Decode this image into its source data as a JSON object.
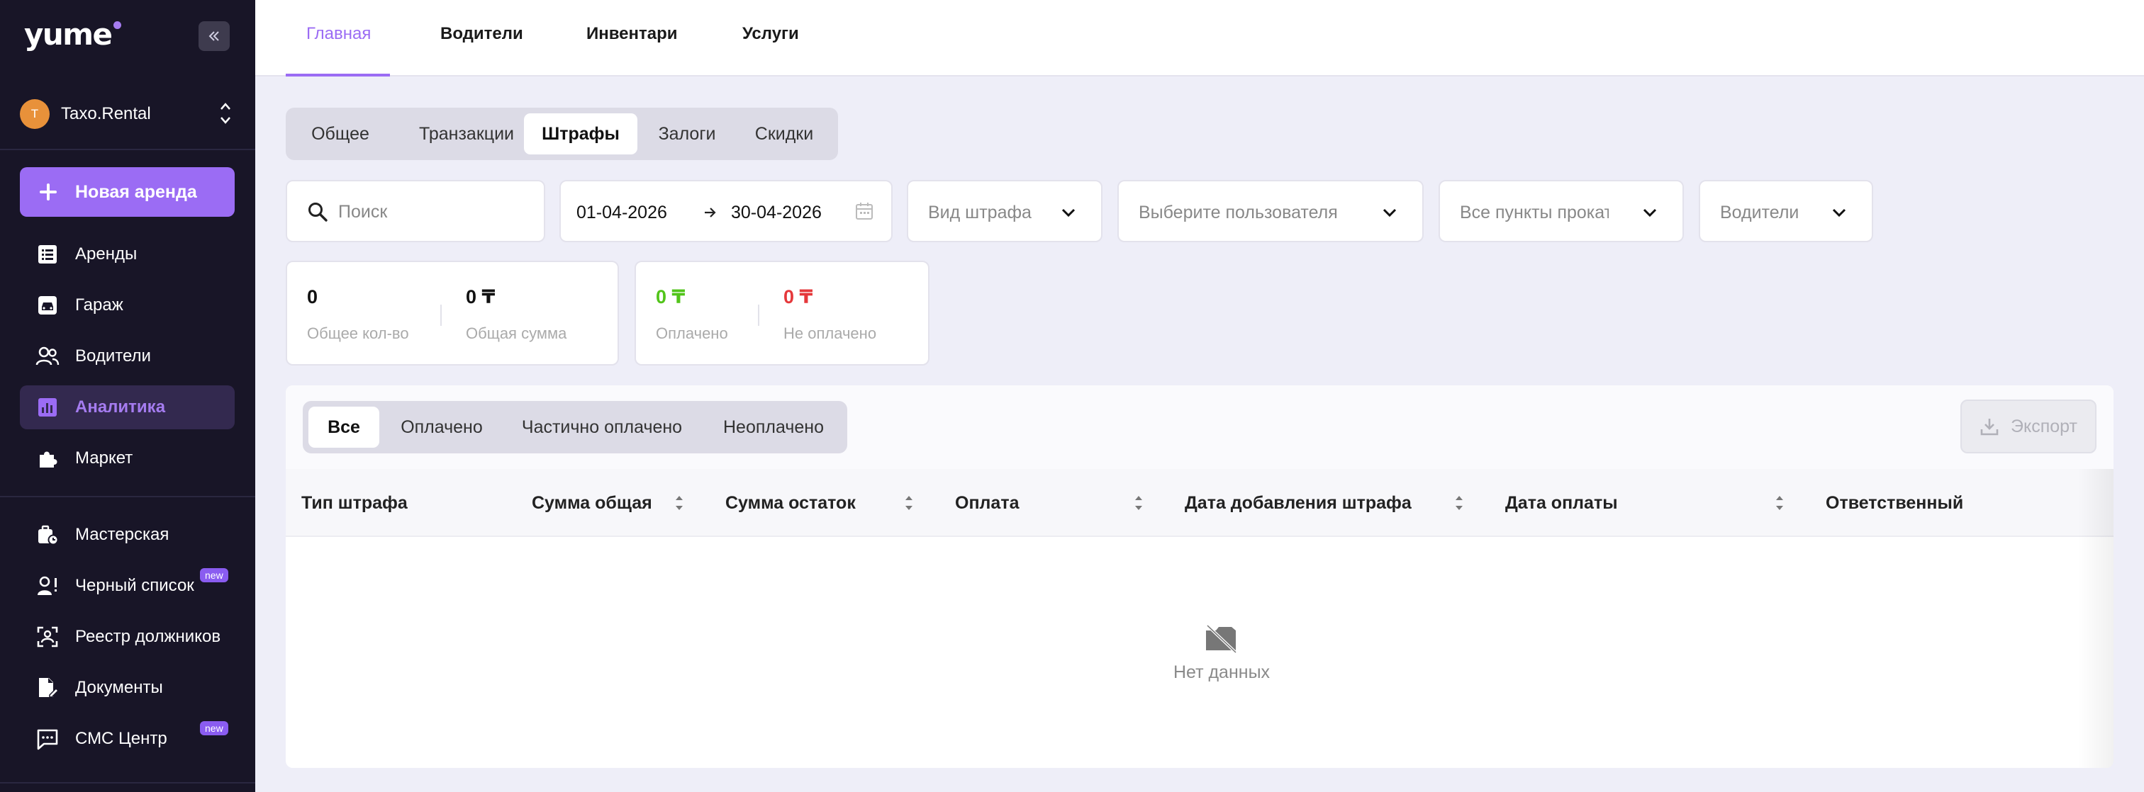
{
  "app": {
    "logo": "yume"
  },
  "org": {
    "initial": "T",
    "name": "Taxo.Rental"
  },
  "sidebar": {
    "new_rent_label": "Новая аренда",
    "items": [
      {
        "label": "Аренды",
        "icon": "list-icon"
      },
      {
        "label": "Гараж",
        "icon": "car-icon"
      },
      {
        "label": "Водители",
        "icon": "users-icon"
      },
      {
        "label": "Аналитика",
        "icon": "chart-icon",
        "active": true
      },
      {
        "label": "Маркет",
        "icon": "puzzle-icon"
      },
      {
        "label": "Мастерская",
        "icon": "toolbox-icon"
      },
      {
        "label": "Черный список",
        "icon": "user-alert-icon",
        "badge": "new"
      },
      {
        "label": "Реестр должников",
        "icon": "user-scan-icon"
      },
      {
        "label": "Документы",
        "icon": "document-edit-icon"
      },
      {
        "label": "СМС Центр",
        "icon": "message-icon",
        "badge": "new"
      }
    ]
  },
  "top_tabs": [
    {
      "label": "Главная",
      "active": true
    },
    {
      "label": "Водители"
    },
    {
      "label": "Инвентари"
    },
    {
      "label": "Услуги"
    }
  ],
  "sub_tabs": [
    {
      "label": "Общее"
    },
    {
      "label": "Транзакции"
    },
    {
      "label": "Штрафы",
      "active": true
    },
    {
      "label": "Залоги"
    },
    {
      "label": "Скидки"
    }
  ],
  "filters": {
    "search_placeholder": "Поиск",
    "date_from": "01-04-2026",
    "date_to": "30-04-2026",
    "fine_type": "Вид штрафа",
    "user": "Выберите пользователя",
    "points": "Все пункты проката",
    "drivers": "Водители"
  },
  "stats": {
    "total_count": {
      "value": "0",
      "label": "Общее кол-во"
    },
    "total_sum": {
      "value": "0 ₸",
      "label": "Общая сумма"
    },
    "paid": {
      "value": "0 ₸",
      "label": "Оплачено",
      "color": "#52c41a"
    },
    "unpaid": {
      "value": "0 ₸",
      "label": "Не оплачено",
      "color": "#e5383b"
    }
  },
  "status_tabs": [
    {
      "label": "Все",
      "active": true
    },
    {
      "label": "Оплачено"
    },
    {
      "label": "Частично оплачено"
    },
    {
      "label": "Неоплачено"
    }
  ],
  "export_label": "Экспорт",
  "table": {
    "columns": [
      "Тип штрафа",
      "Сумма общая",
      "Сумма остаток",
      "Оплата",
      "Дата добавления штрафа",
      "Дата оплаты",
      "Ответственный"
    ],
    "empty_label": "Нет данных"
  },
  "colors": {
    "accent": "#9b6cf4",
    "sidebar_bg": "#181527"
  }
}
